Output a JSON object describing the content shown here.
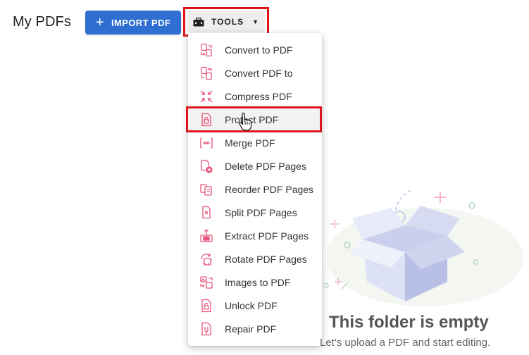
{
  "header": {
    "title": "My PDFs",
    "import_label": "IMPORT PDF",
    "import_icon": "plus-icon",
    "tools_label": "TOOLS",
    "tools_icon": "toolbox-icon",
    "tools_caret_icon": "caret-down-icon"
  },
  "menu": {
    "items": [
      {
        "label": "Convert to PDF",
        "icon": "convert-to-pdf-icon"
      },
      {
        "label": "Convert PDF to",
        "icon": "convert-pdf-to-icon"
      },
      {
        "label": "Compress PDF",
        "icon": "compress-icon"
      },
      {
        "label": "Protect PDF",
        "icon": "lock-file-icon"
      },
      {
        "label": "Merge PDF",
        "icon": "merge-icon"
      },
      {
        "label": "Delete PDF Pages",
        "icon": "delete-pages-icon"
      },
      {
        "label": "Reorder PDF Pages",
        "icon": "reorder-pages-icon"
      },
      {
        "label": "Split PDF Pages",
        "icon": "split-pages-icon"
      },
      {
        "label": "Extract PDF Pages",
        "icon": "extract-pages-icon"
      },
      {
        "label": "Rotate PDF Pages",
        "icon": "rotate-pages-icon"
      },
      {
        "label": "Images to PDF",
        "icon": "images-to-pdf-icon"
      },
      {
        "label": "Unlock PDF",
        "icon": "unlock-file-icon"
      },
      {
        "label": "Repair PDF",
        "icon": "repair-file-icon"
      }
    ]
  },
  "empty_state": {
    "title": "This folder is empty",
    "subtitle": "Let's upload a PDF and start editing."
  },
  "colors": {
    "accent": "#2f6fd1",
    "icon_pink": "#e8557a",
    "highlight_red": "#e0151c"
  }
}
